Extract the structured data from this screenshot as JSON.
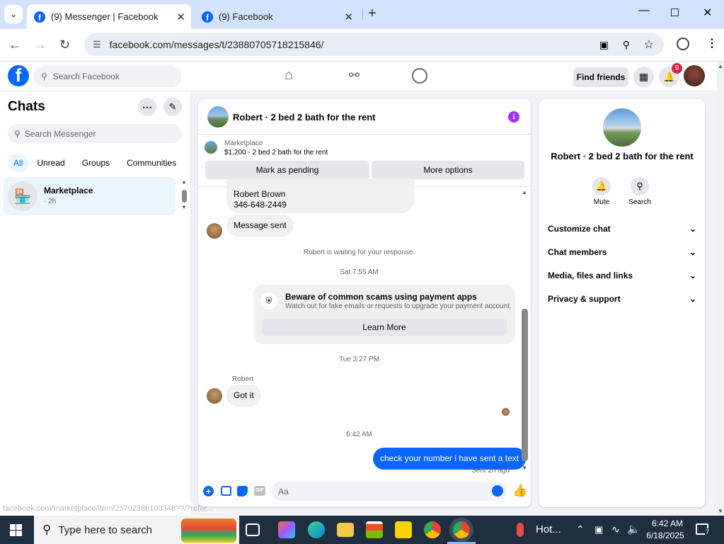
{
  "browser": {
    "tabs": [
      {
        "title": "(9) Messenger | Facebook",
        "active": true
      },
      {
        "title": "(9) Facebook",
        "active": false
      }
    ],
    "url": "facebook.com/messages/t/23880705718215846/",
    "status_url": "facebook.com/marketplace/item/25702386100348??/?refer..."
  },
  "facebook": {
    "search_placeholder": "Search Facebook",
    "find_friends": "Find friends",
    "notification_count": "9"
  },
  "chats": {
    "title": "Chats",
    "search_placeholder": "Search Messenger",
    "filters": [
      "All",
      "Unread",
      "Groups",
      "Communities"
    ],
    "items": [
      {
        "name": "Marketplace",
        "meta": "· 2h"
      }
    ]
  },
  "conversation": {
    "title": "Robert · 2 bed 2 bath for the rent",
    "listing_label": "Marketplace",
    "listing_detail": "$1,200 - 2 bed 2 bath for the rent",
    "mark_pending": "Mark as pending",
    "more_options": "More options",
    "messages": {
      "contact_name": "Robert Brown",
      "contact_phone": "346-648-2449",
      "message_sent": "Message sent",
      "waiting": "Robert is waiting for your response.",
      "time1": "Sat 7:55 AM",
      "scam_title": "Beware of common scams using payment apps",
      "scam_body": "Watch out for fake emails or requests to upgrade your payment account.",
      "learn_more": "Learn More",
      "time2": "Tue 3:27 PM",
      "sender": "Robert",
      "got_it": "Got it",
      "time3": "6:42 AM",
      "my_msg": "check your number i have sent a text",
      "sent_status": "Sent 2h ago"
    },
    "composer_placeholder": "Aa"
  },
  "details": {
    "title": "Robert · 2 bed 2 bath for the rent",
    "mute": "Mute",
    "search": "Search",
    "sections": [
      "Customize chat",
      "Chat members",
      "Media, files and links",
      "Privacy & support"
    ]
  },
  "taskbar": {
    "search_placeholder": "Type here to search",
    "weather": "Hot...",
    "time": "6:42 AM",
    "date": "6/18/2025",
    "notif_count": "7"
  },
  "colors": {
    "fb_blue": "#0866ff",
    "messenger_purple": "#a033ff",
    "tab_bg": "#d3e3fd",
    "badge_red": "#e41e3f"
  }
}
